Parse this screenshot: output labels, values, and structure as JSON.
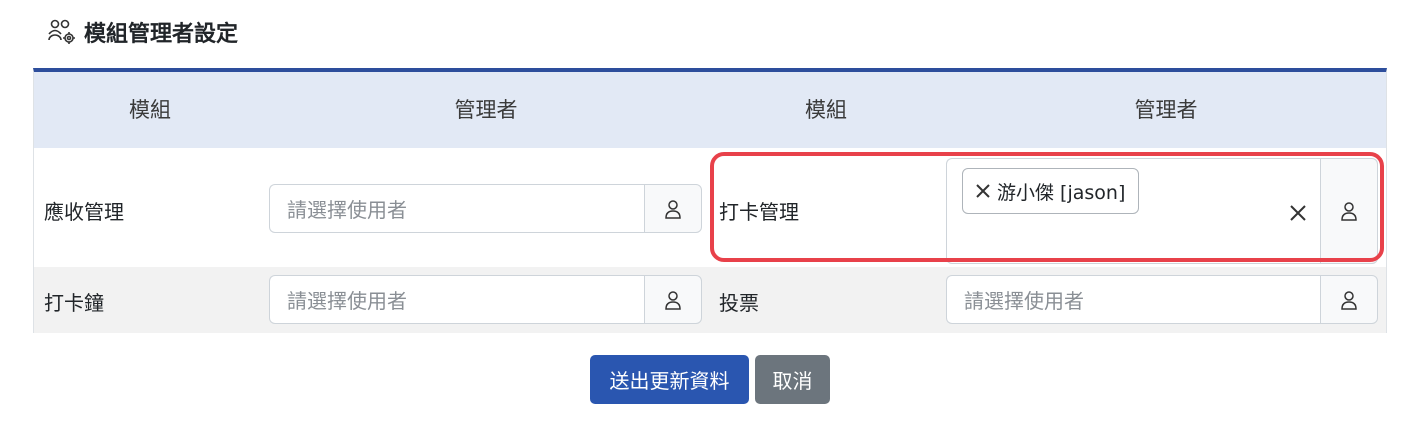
{
  "header": {
    "title": "模組管理者設定",
    "icon": "users-gear-icon"
  },
  "table": {
    "columns": [
      "模組",
      "管理者",
      "模組",
      "管理者"
    ],
    "rows": [
      {
        "left": {
          "module": "應收管理",
          "placeholder": "請選擇使用者"
        },
        "right": {
          "module": "打卡管理",
          "selected_tag": "游小傑 [jason]"
        }
      },
      {
        "left": {
          "module": "打卡鐘",
          "placeholder": "請選擇使用者"
        },
        "right": {
          "module": "投票",
          "placeholder": "請選擇使用者"
        }
      }
    ]
  },
  "actions": {
    "submit": "送出更新資料",
    "cancel": "取消"
  },
  "colors": {
    "primary": "#2a56b0",
    "secondary": "#6c757d",
    "highlight": "#e8414a",
    "header_bg": "#e2e9f5",
    "table_border_top": "#2d4e9c"
  }
}
